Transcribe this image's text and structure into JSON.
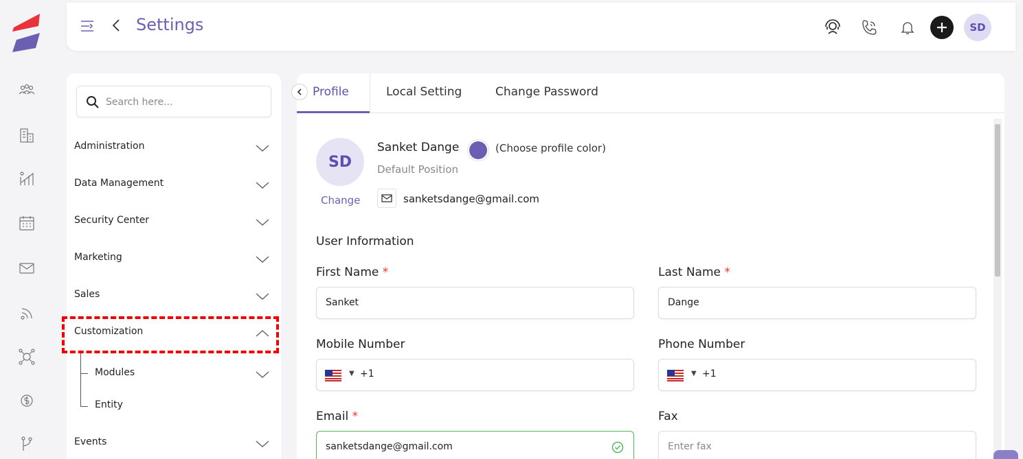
{
  "header": {
    "title": "Settings",
    "avatar_initials": "SD"
  },
  "search": {
    "placeholder": "Search here..."
  },
  "settings_nav": {
    "items": [
      {
        "label": "Administration"
      },
      {
        "label": "Data Management"
      },
      {
        "label": "Security Center"
      },
      {
        "label": "Marketing"
      },
      {
        "label": "Sales"
      },
      {
        "label": "Customization",
        "expanded": true
      },
      {
        "label": "Events"
      }
    ],
    "customization_children": [
      {
        "label": "Modules"
      },
      {
        "label": "Entity"
      }
    ]
  },
  "tabs": [
    {
      "label": "Profile",
      "active": true
    },
    {
      "label": "Local Setting"
    },
    {
      "label": "Change Password"
    }
  ],
  "profile": {
    "initials": "SD",
    "change_label": "Change",
    "name": "Sanket Dange",
    "choose_color_label": "(Choose profile color)",
    "position": "Default Position",
    "email": "sanketsdange@gmail.com",
    "profile_color": "#6a5fb3"
  },
  "user_info": {
    "section_title": "User Information",
    "first_name_label": "First Name",
    "first_name_value": "Sanket",
    "last_name_label": "Last Name",
    "last_name_value": "Dange",
    "mobile_label": "Mobile Number",
    "mobile_code": "+1",
    "phone_label": "Phone Number",
    "phone_code": "+1",
    "email_label": "Email",
    "email_value": "sanketsdange@gmail.com",
    "fax_label": "Fax",
    "fax_placeholder": "Enter fax",
    "required_mark": "*"
  },
  "colors": {
    "accent": "#6a5fb3",
    "highlight": "#e00000",
    "valid": "#5cb85c"
  }
}
